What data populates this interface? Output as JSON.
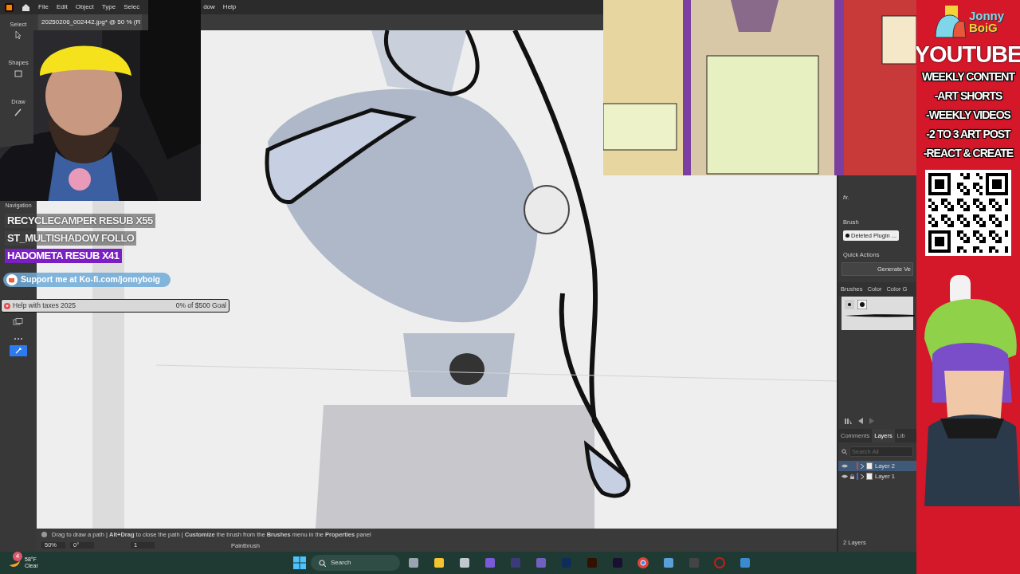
{
  "menu": {
    "items": [
      "File",
      "Edit",
      "Object",
      "Type",
      "Selec",
      "dow",
      "Help"
    ]
  },
  "document_tab": {
    "title": "20250206_002442.jpg* @ 50 % (R"
  },
  "toolbar": {
    "sections": [
      "Select",
      "Shapes",
      "Draw"
    ],
    "navigation": "Navigation"
  },
  "alerts": [
    {
      "text": "RECYCLECAMPER  RESUB X55",
      "highlighted": false
    },
    {
      "text": "ST_MULTISHADOW  FOLLO",
      "highlighted": false
    },
    {
      "text": "HADOMETA  RESUB X41",
      "highlighted": true
    }
  ],
  "kofi": {
    "text": "Support me at Ko-fi.com/jonnyboig"
  },
  "goal": {
    "title": "Help with taxes 2025",
    "reading": "0% of $500 Goal",
    "level": 0
  },
  "properties": {
    "fx": "fx.",
    "brush_label": "Brush",
    "brush_value": "Deleted Plugin ...",
    "quick_actions": "Quick Actions",
    "action_button": "Generate Ve"
  },
  "brush_tabs": [
    "Brushes",
    "Color",
    "Color G"
  ],
  "layers_panel": {
    "tabs": [
      {
        "label": "Comments",
        "selected": false
      },
      {
        "label": "Layers",
        "selected": true
      },
      {
        "label": "Lib",
        "selected": false
      }
    ],
    "search": {
      "placeholder": "Search All"
    },
    "layers": [
      {
        "name": "Layer 2",
        "selected": true,
        "locked": false,
        "color": "#d9434f"
      },
      {
        "name": "Layer 1",
        "selected": false,
        "locked": true,
        "color": "#4f5fd9"
      }
    ],
    "count": "2 Layers"
  },
  "status_bar": {
    "hint": "Drag to draw a path  |  **Alt+Drag** to close the path  |  **Customize** the brush from the **Brushes** menu in the **Properties** panel",
    "zoom": "50%",
    "rotation": "0°",
    "artboard": "1",
    "tool": "Paintbrush"
  },
  "taskbar": {
    "badge": "4",
    "temperature": "58°F",
    "condition": "Clear",
    "search": "Search"
  },
  "promo": {
    "logo_top": "Jonny",
    "logo_bottom": "BoiG",
    "heading": "YOUTUBE",
    "lines": [
      "WEEKLY CONTENT",
      "-ART SHORTS",
      "-WEEKLY VIDEOS",
      "-2 TO 3 ART POST",
      "-REACT & CREATE"
    ]
  }
}
